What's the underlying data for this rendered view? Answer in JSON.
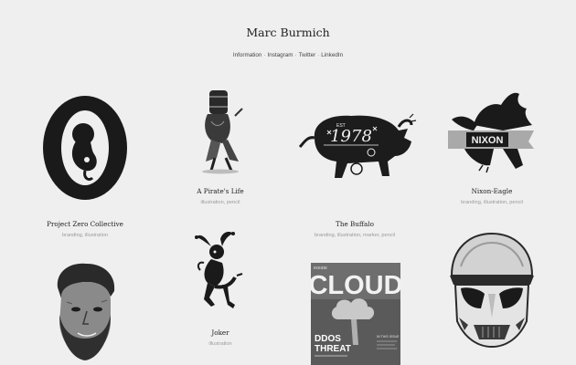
{
  "site": {
    "title": "Marc Burmich",
    "nav": [
      "Information",
      "Instagram",
      "Twitter",
      "LinkedIn"
    ]
  },
  "works": [
    {
      "title": "Project Zero Collective",
      "tags": "branding, illustration"
    },
    {
      "title": "A Pirate's Life",
      "tags": "illustration, pencil"
    },
    {
      "title": "The Buffalo",
      "tags": "branding, illustration, marker, pencil"
    },
    {
      "title": "Nixon-Eagle",
      "tags": "branding, illustration, pencil"
    },
    {
      "title": "Joker",
      "tags": "illustration"
    }
  ],
  "art_text": {
    "buffalo_year": "1978",
    "buffalo_est": "EST",
    "nixon": "NIXON",
    "magazine_title": "CLOUD",
    "magazine_kicker": "INSIDE",
    "magazine_headline_1": "DDOS",
    "magazine_headline_2": "THREAT",
    "magazine_side": "IN THIS ISSUE"
  }
}
